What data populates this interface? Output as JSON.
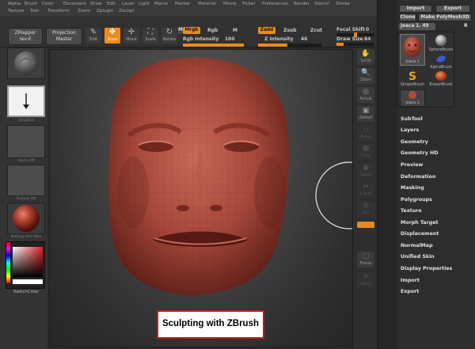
{
  "menubar": {
    "row1": [
      "Alpha",
      "Brush",
      "Color",
      "Document",
      "Draw",
      "Edit",
      "Layer",
      "Light",
      "Macro",
      "Marker",
      "Material",
      "Movie",
      "Picker",
      "Preferences",
      "Render",
      "Stencil",
      "Stroke"
    ],
    "row2": [
      "Texture",
      "Tool",
      "Transform",
      "Zoom",
      "Zplugin",
      "Zscript"
    ]
  },
  "shelf": {
    "zmapper_line1": "ZMapper",
    "zmapper_line2": "rev-E",
    "projection_line1": "Projection",
    "projection_line2": "Master",
    "tools": [
      {
        "label": "Edit",
        "icon": "✎"
      },
      {
        "label": "Draw",
        "icon": "✥"
      },
      {
        "label": "Move",
        "icon": "✢"
      },
      {
        "label": "Scale",
        "icon": "⛶"
      },
      {
        "label": "Rotate",
        "icon": "↻"
      }
    ],
    "m": "M",
    "mrgb": "Mrgb",
    "rgb": "Rgb",
    "rgb_intensity_label": "Rgb Intensity",
    "rgb_intensity_value": "100",
    "zadd": "Zadd",
    "zsub": "Zsub",
    "zcut": "Zcut",
    "z_intensity_label": "Z Intensity",
    "z_intensity_value": "46",
    "focal_shift_label": "Focal Shift",
    "focal_shift_value": "0",
    "draw_size_label": "Draw Size",
    "draw_size_value": "64"
  },
  "left_tray": {
    "alpha_label": "Alpha Off",
    "dragdot_label": "DragDot",
    "texture_label": "Texture Off",
    "material_label": "MatCap Red Wax",
    "switch_color_label": "SwitchColor"
  },
  "canvas": {
    "caption": "Sculpting with ZBrush"
  },
  "right_icons": [
    {
      "label": "Scroll",
      "icon": "✋"
    },
    {
      "label": "Zoom",
      "icon": "🔍"
    },
    {
      "label": "Actual",
      "icon": "◎"
    },
    {
      "label": "AAHalf",
      "icon": "▣"
    },
    {
      "label": "Persp",
      "icon": "◇"
    },
    {
      "label": "Floor",
      "icon": "▦"
    },
    {
      "label": "Local",
      "icon": "◉"
    },
    {
      "label": "L.Sym",
      "icon": "⇔"
    },
    {
      "label": "Xyz",
      "icon": "✣"
    },
    {
      "label": "Frame",
      "icon": "⬚"
    },
    {
      "label": "Move",
      "icon": "✢"
    }
  ],
  "right_panel": {
    "import": "Import",
    "export": "Export",
    "clone": "Clone",
    "make_polymesh": "Make PolyMesh3D",
    "current_tool": "joaca 1. 49",
    "r": "R",
    "brushes": [
      {
        "label": "joaca 1"
      },
      {
        "label": "SphereBrush"
      },
      {
        "label": "AlphaBrush"
      },
      {
        "label": "SimpleBrush"
      },
      {
        "label": "EraserBrush"
      },
      {
        "label": "joaca 1"
      }
    ],
    "menu": [
      "SubTool",
      "Layers",
      "Geometry",
      "Geometry HD",
      "Preview",
      "Deformation",
      "Masking",
      "Polygroups",
      "Texture",
      "Morph Target",
      "Displacement",
      "NormalMap",
      "Unified Skin",
      "Display Properties",
      "Import",
      "Export"
    ]
  }
}
